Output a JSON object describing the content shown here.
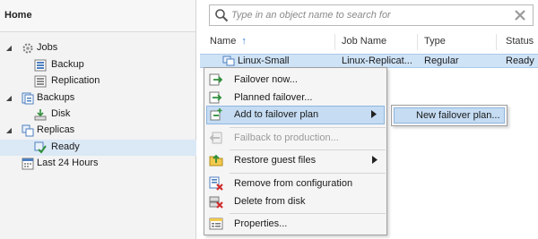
{
  "nav": {
    "header": "Home",
    "items": [
      {
        "label": "Jobs",
        "icon": "jobs-icon"
      },
      {
        "label": "Backup",
        "icon": "backup-job-icon"
      },
      {
        "label": "Replication",
        "icon": "replication-job-icon"
      },
      {
        "label": "Backups",
        "icon": "backups-icon"
      },
      {
        "label": "Disk",
        "icon": "disk-icon"
      },
      {
        "label": "Replicas",
        "icon": "replicas-icon"
      },
      {
        "label": "Ready",
        "icon": "ready-replica-icon"
      },
      {
        "label": "Last 24 Hours",
        "icon": "last-24-hours-icon"
      }
    ]
  },
  "search": {
    "placeholder": "Type in an object name to search for"
  },
  "table": {
    "columns": [
      "Name",
      "Job Name",
      "Type",
      "Status"
    ],
    "sort_indicator": "↑",
    "rows": [
      {
        "name": "Linux-Small",
        "job_name": "Linux-Replicat...",
        "type": "Regular",
        "status": "Ready"
      }
    ]
  },
  "context_menu": {
    "items": [
      {
        "label": "Failover now...",
        "icon": "failover-now-icon"
      },
      {
        "label": "Planned failover...",
        "icon": "planned-failover-icon"
      },
      {
        "label": "Add to failover plan",
        "icon": "add-to-failover-plan-icon",
        "submenu": true,
        "highlighted": true
      },
      {
        "label": "Failback to production...",
        "icon": "failback-icon",
        "disabled": true
      },
      {
        "label": "Restore guest files",
        "icon": "restore-guest-files-icon",
        "submenu": true
      },
      {
        "label": "Remove from configuration",
        "icon": "remove-from-configuration-icon"
      },
      {
        "label": "Delete from disk",
        "icon": "delete-from-disk-icon"
      },
      {
        "label": "Properties...",
        "icon": "properties-icon"
      }
    ]
  },
  "submenu": {
    "items": [
      {
        "label": "New failover plan..."
      }
    ]
  },
  "colors": {
    "selection": "#cfe3f7",
    "menu_highlight": "#c5dcf3",
    "accent": "#2e7bd6"
  }
}
